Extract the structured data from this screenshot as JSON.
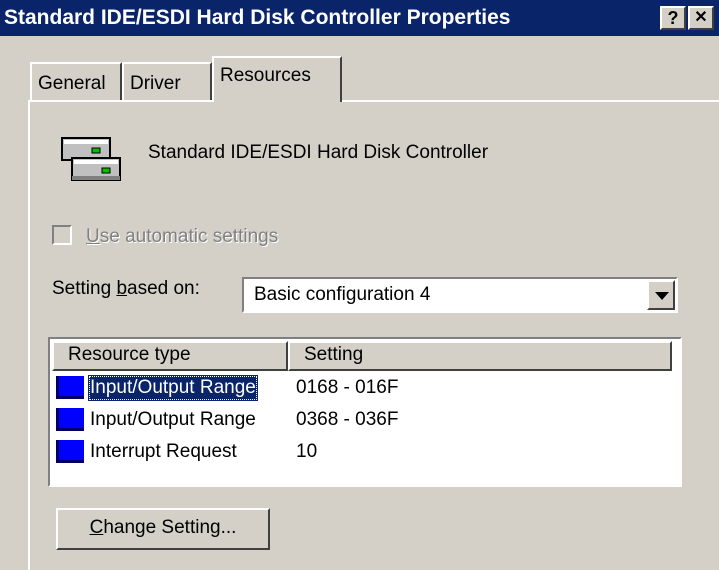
{
  "titlebar": {
    "title": "Standard IDE/ESDI Hard Disk Controller Properties",
    "help_label": "?",
    "close_label": "✕"
  },
  "tabs": [
    {
      "label": "General",
      "active": false
    },
    {
      "label": "Driver",
      "active": false
    },
    {
      "label": "Resources",
      "active": true
    }
  ],
  "device": {
    "icon": "disk-controller-icon",
    "name": "Standard IDE/ESDI Hard Disk Controller"
  },
  "automatic_settings": {
    "label_mnemonic": "U",
    "label_rest": "se automatic settings",
    "checked": false,
    "enabled": false
  },
  "setting_based_on": {
    "label_before": "Setting ",
    "label_mnemonic": "b",
    "label_after": "ased on:",
    "value": "Basic configuration 4"
  },
  "resources": {
    "columns": [
      "Resource type",
      "Setting"
    ],
    "rows": [
      {
        "type": "Input/Output Range",
        "setting": "0168 - 016F",
        "selected": true
      },
      {
        "type": "Input/Output Range",
        "setting": "0368 - 036F",
        "selected": false
      },
      {
        "type": "Interrupt Request",
        "setting": "10",
        "selected": false
      }
    ]
  },
  "change_button": {
    "mnemonic": "C",
    "rest": "hange Setting..."
  },
  "colors": {
    "titlebar": "#0a246a",
    "face": "#d4d0c8",
    "resource_icon": "#0000ff"
  }
}
